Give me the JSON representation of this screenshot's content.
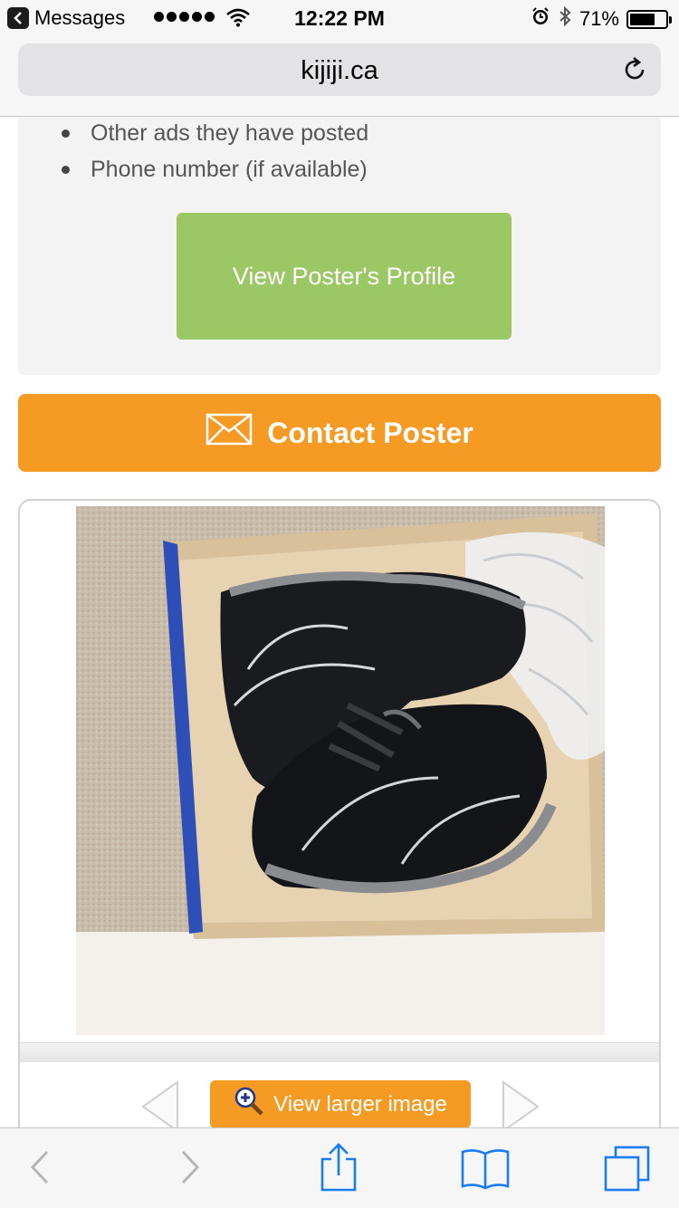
{
  "status_bar": {
    "back_app": "Messages",
    "time": "12:22 PM",
    "battery": "71%",
    "battery_level": 0.71
  },
  "browser": {
    "url": "kijiji.ca"
  },
  "poster_info": {
    "items": [
      "Other ads they have posted",
      "Phone number (if available)"
    ],
    "profile_button": "View Poster's Profile"
  },
  "contact": {
    "label": "Contact Poster"
  },
  "image_viewer": {
    "larger_label": "View larger image"
  },
  "colors": {
    "green": "#9bc865",
    "orange": "#f59a23",
    "ios_blue": "#1a7cf5"
  },
  "icons": {
    "back": "chevron-left-icon",
    "forward": "chevron-right-icon",
    "share": "share-icon",
    "bookmarks": "book-icon",
    "tabs": "tabs-icon",
    "reload": "reload-icon",
    "mail": "envelope-icon",
    "zoom": "magnifier-plus-icon"
  }
}
